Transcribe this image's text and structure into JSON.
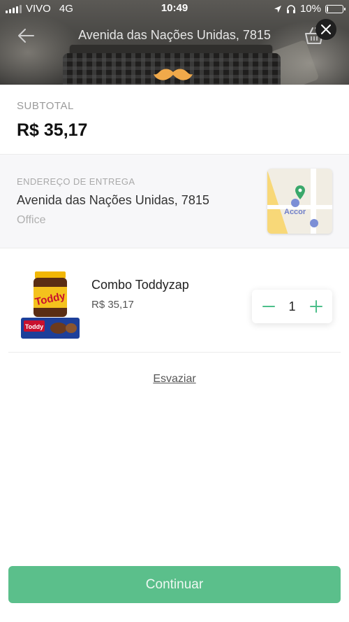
{
  "status_bar": {
    "carrier": "VIVO",
    "network": "4G",
    "time": "10:49",
    "battery_percent_label": "10%",
    "battery_level": 0.1
  },
  "header": {
    "title": "Avenida das Nações Unidas, 7815",
    "icons": {
      "back": "arrow-left-icon",
      "cart": "basket-icon",
      "close": "close-icon"
    }
  },
  "subtotal": {
    "label": "SUBTOTAL",
    "value": "R$ 35,17"
  },
  "delivery": {
    "label": "ENDEREÇO DE ENTREGA",
    "street": "Avenida das Nações Unidas, 7815",
    "complement": "Office",
    "map_poi": "Accor"
  },
  "cart_items": [
    {
      "name": "Combo Toddyzap",
      "price": "R$ 35,17",
      "quantity": "1"
    }
  ],
  "actions": {
    "empty_cart": "Esvaziar",
    "continue": "Continuar"
  },
  "colors": {
    "accent": "#5bbf8b",
    "stepper_icon": "#4cbf8a",
    "map_pin": "#3aa86b"
  }
}
